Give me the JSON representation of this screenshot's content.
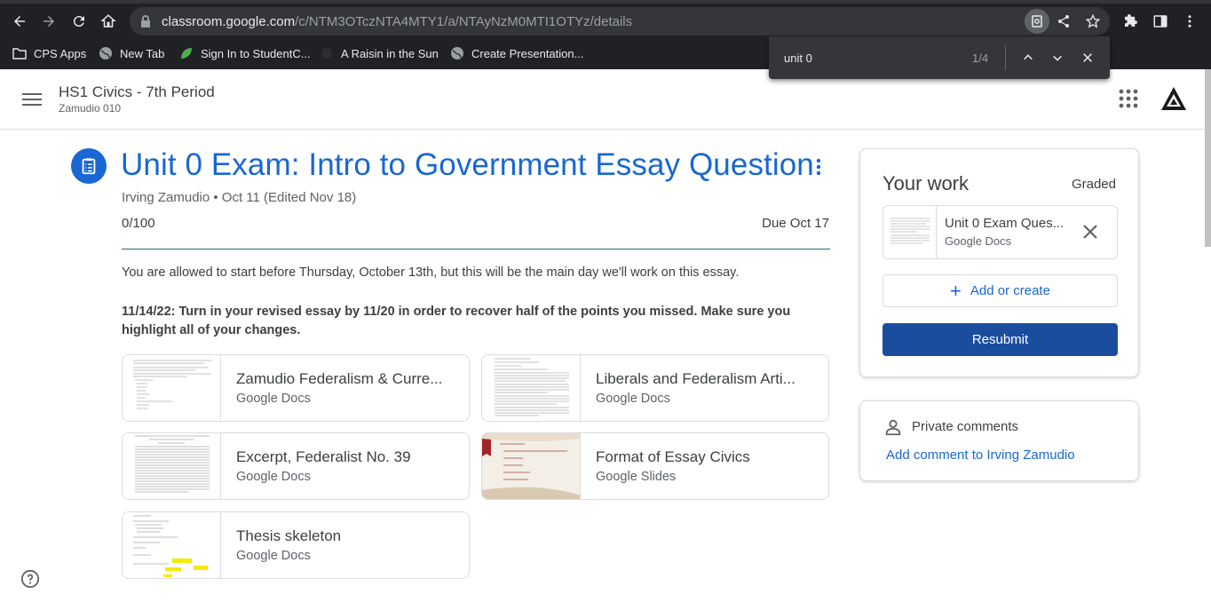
{
  "browser": {
    "url_host": "classroom.google.com",
    "url_path": "/c/NTM3OTczNTA4MTY1/a/NTAyNzM0MTI1OTYz/details",
    "bookmarks": [
      {
        "label": "CPS Apps",
        "icon": "folder-icon"
      },
      {
        "label": "New Tab",
        "icon": "globe-icon"
      },
      {
        "label": "Sign In to StudentC...",
        "icon": "leaf-icon"
      },
      {
        "label": "A Raisin in the Sun",
        "icon": "page-icon"
      },
      {
        "label": "Create Presentation...",
        "icon": "globe-icon"
      }
    ],
    "find": {
      "query": "unit 0",
      "count": "1/4"
    }
  },
  "header": {
    "class_title": "HS1 Civics - 7th Period",
    "class_subtitle": "Zamudio 010"
  },
  "assignment": {
    "title": "Unit 0 Exam: Intro to Government Essay Question",
    "meta": "Irving Zamudio • Oct 11 (Edited Nov 18)",
    "points": "0/100",
    "due": "Due Oct 17",
    "description_1": "You are allowed to start before Thursday, October 13th, but this will be the main day we'll work on this essay.",
    "description_2": "11/14/22: Turn in your revised essay by 11/20 in order to recover half of the points you missed. Make sure you highlight all of your changes.",
    "attachments": [
      {
        "title": "Zamudio Federalism & Curre...",
        "type": "Google Docs"
      },
      {
        "title": "Liberals and Federalism Arti...",
        "type": "Google Docs"
      },
      {
        "title": "Excerpt, Federalist No. 39",
        "type": "Google Docs"
      },
      {
        "title": "Format of Essay Civics",
        "type": "Google Slides"
      },
      {
        "title": "Thesis skeleton",
        "type": "Google Docs"
      }
    ]
  },
  "your_work": {
    "title": "Your work",
    "status": "Graded",
    "file_title": "Unit 0 Exam Ques...",
    "file_type": "Google Docs",
    "add_label": "Add or create",
    "resubmit_label": "Resubmit"
  },
  "private_comments": {
    "title": "Private comments",
    "link": "Add comment to Irving Zamudio"
  },
  "colors": {
    "accent": "#1967d2",
    "resubmit": "#1a4d9e",
    "chrome": "#202124"
  }
}
